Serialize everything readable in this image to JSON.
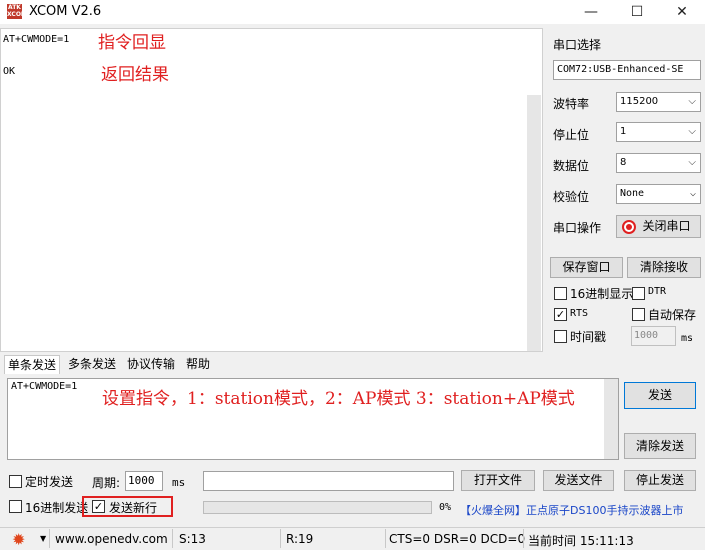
{
  "window": {
    "title": "XCOM V2.6",
    "logo_text": "ATK XCOM",
    "minimize": "—",
    "maximize": "☐",
    "close": "✕"
  },
  "receive": {
    "line1": "AT+CWMODE=1",
    "line2": "OK",
    "annotation_echo": "指令回显",
    "annotation_result": "返回结果"
  },
  "right_panel": {
    "port_select_label": "串口选择",
    "port_value": "COM72:USB-Enhanced-SE",
    "baud_label": "波特率",
    "baud_value": "115200",
    "stopbit_label": "停止位",
    "stopbit_value": "1",
    "databit_label": "数据位",
    "databit_value": "8",
    "parity_label": "校验位",
    "parity_value": "None",
    "port_op_label": "串口操作",
    "close_port_button": "关闭串口",
    "save_window_button": "保存窗口",
    "clear_receive_button": "清除接收",
    "hex_display_label": "16进制显示",
    "dtr_label": "DTR",
    "rts_label": "RTS",
    "autosave_label": "自动保存",
    "timestamp_label": "时间戳",
    "timestamp_value": "1000",
    "timestamp_unit": "ms"
  },
  "tabs": [
    "单条发送",
    "多条发送",
    "协议传输",
    "帮助"
  ],
  "send": {
    "text": "AT+CWMODE=1",
    "annotation": "设置指令，1：station模式，2：AP模式 3：station+AP模式",
    "send_button": "发送",
    "clear_send_button": "清除发送",
    "timed_send_label": "定时发送",
    "period_label": "周期:",
    "period_value": "1000",
    "period_unit": "ms",
    "open_file_button": "打开文件",
    "send_file_button": "发送文件",
    "stop_send_button": "停止发送",
    "hex_send_label": "16进制发送",
    "send_newline_label": "发送新行",
    "progress": "0%",
    "promo_text": "【火爆全网】正点原子DS100手持示波器上市"
  },
  "statusbar": {
    "url": "www.openedv.com",
    "s_count": "S:13",
    "r_count": "R:19",
    "signals": "CTS=0 DSR=0 DCD=0",
    "time": "当前时间 15:11:13"
  },
  "checkboxes": {
    "hex_display": false,
    "dtr": false,
    "rts": true,
    "autosave": false,
    "timestamp": false,
    "timed_send": false,
    "hex_send": false,
    "send_newline": true
  },
  "colors": {
    "annotation": "#e02020",
    "promo": "#1a46c8",
    "gear": "#e0461c"
  },
  "icons": [
    "app-logo-icon",
    "minimize-icon",
    "maximize-icon",
    "close-icon",
    "record-icon",
    "gear-icon",
    "chevron-down-icon"
  ]
}
